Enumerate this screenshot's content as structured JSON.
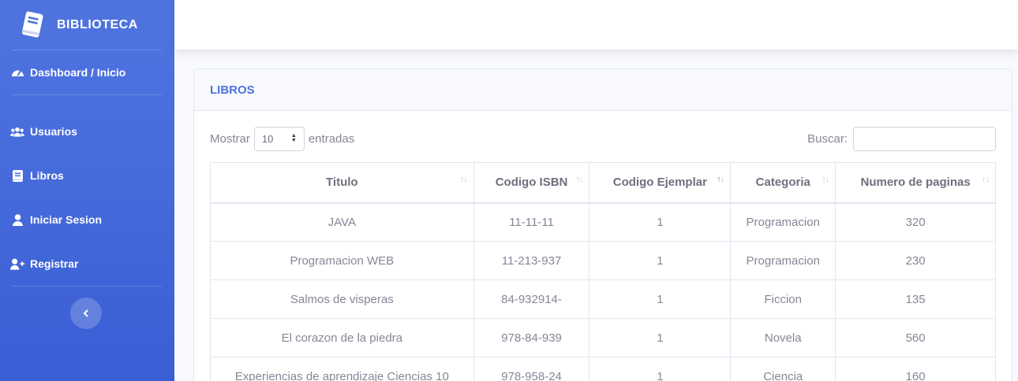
{
  "sidebar": {
    "brand": "BIBLIOTECA",
    "items": [
      {
        "label": "Dashboard / Inicio",
        "icon": "dashboard-icon"
      },
      {
        "label": "Usuarios",
        "icon": "users-icon"
      },
      {
        "label": "Libros",
        "icon": "book-icon"
      },
      {
        "label": "Iniciar Sesion",
        "icon": "user-icon"
      },
      {
        "label": "Registrar",
        "icon": "user-plus-icon"
      }
    ]
  },
  "card": {
    "title": "LIBROS",
    "length_prefix": "Mostrar",
    "length_value": "10",
    "length_suffix": "entradas",
    "search_label": "Buscar:",
    "search_value": ""
  },
  "table": {
    "columns": [
      "Titulo",
      "Codigo ISBN",
      "Codigo Ejemplar",
      "Categoria",
      "Numero de paginas"
    ],
    "sorted_column": "Codigo Ejemplar",
    "rows": [
      [
        "JAVA",
        "11-11-11",
        "1",
        "Programacion",
        "320"
      ],
      [
        "Programacion WEB",
        "11-213-937",
        "1",
        "Programacion",
        "230"
      ],
      [
        "Salmos de visperas",
        "84-932914-",
        "1",
        "Ficcion",
        "135"
      ],
      [
        "El corazon de la piedra",
        "978-84-939",
        "1",
        "Novela",
        "560"
      ],
      [
        "Experiencias de aprendizaje Ciencias 10",
        "978-958-24",
        "1",
        "Ciencia",
        "160"
      ]
    ]
  },
  "colors": {
    "primary": "#4e73df",
    "text": "#858796"
  }
}
